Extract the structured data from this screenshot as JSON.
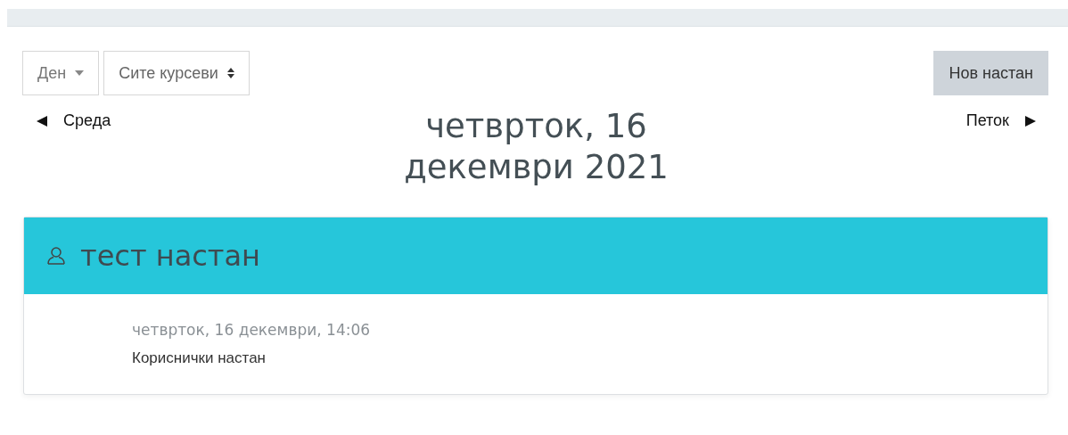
{
  "view_select": {
    "value": "Ден"
  },
  "course_select": {
    "value": "Сите курсеви"
  },
  "new_event_button": "Нов настан",
  "prev_day": "Среда",
  "next_day": "Петок",
  "day_title": "четврток, 16 декември 2021",
  "events": [
    {
      "title": "тест настан",
      "kind": "user",
      "time": "четврток, 16 декември, 14:06",
      "type": "Кориснички настан"
    }
  ]
}
